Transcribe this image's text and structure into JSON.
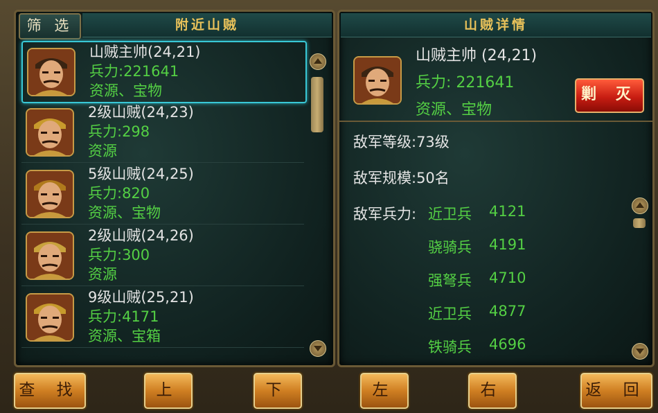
{
  "left_panel": {
    "filter_label": "筛 选",
    "title": "附近山贼",
    "bandits": [
      {
        "name": "山贼主帅(24,21)",
        "troops": "兵力:221641",
        "resources": "资源、宝物",
        "selected": true
      },
      {
        "name": "2级山贼(24,23)",
        "troops": "兵力:298",
        "resources": "资源",
        "selected": false
      },
      {
        "name": "5级山贼(24,25)",
        "troops": "兵力:820",
        "resources": "资源、宝物",
        "selected": false
      },
      {
        "name": "2级山贼(24,26)",
        "troops": "兵力:300",
        "resources": "资源",
        "selected": false
      },
      {
        "name": "9级山贼(25,21)",
        "troops": "兵力:4171",
        "resources": "资源、宝箱",
        "selected": false
      }
    ]
  },
  "right_panel": {
    "title": "山贼详情",
    "name": "山贼主帅  (24,21)",
    "troops": "兵力: 221641",
    "resources": "资源、宝物",
    "attack_label": "剿 灭",
    "enemy_level": "敌军等级:73级",
    "enemy_scale": "敌军规模:50名",
    "enemy_force_label": "敌军兵力:",
    "units": [
      {
        "type": "近卫兵",
        "count": "4121"
      },
      {
        "type": "骁骑兵",
        "count": "4191"
      },
      {
        "type": "强弩兵",
        "count": "4710"
      },
      {
        "type": "近卫兵",
        "count": "4877"
      },
      {
        "type": "铁骑兵",
        "count": "4696"
      }
    ]
  },
  "bottom_buttons": {
    "search": "查 找",
    "up": "上",
    "down": "下",
    "left": "左",
    "right": "右",
    "back": "返 回"
  },
  "colors": {
    "accent_green": "#54d044",
    "title_gold": "#e9c25a",
    "selection": "#39c8d6",
    "attack_red": "#c81d12"
  }
}
